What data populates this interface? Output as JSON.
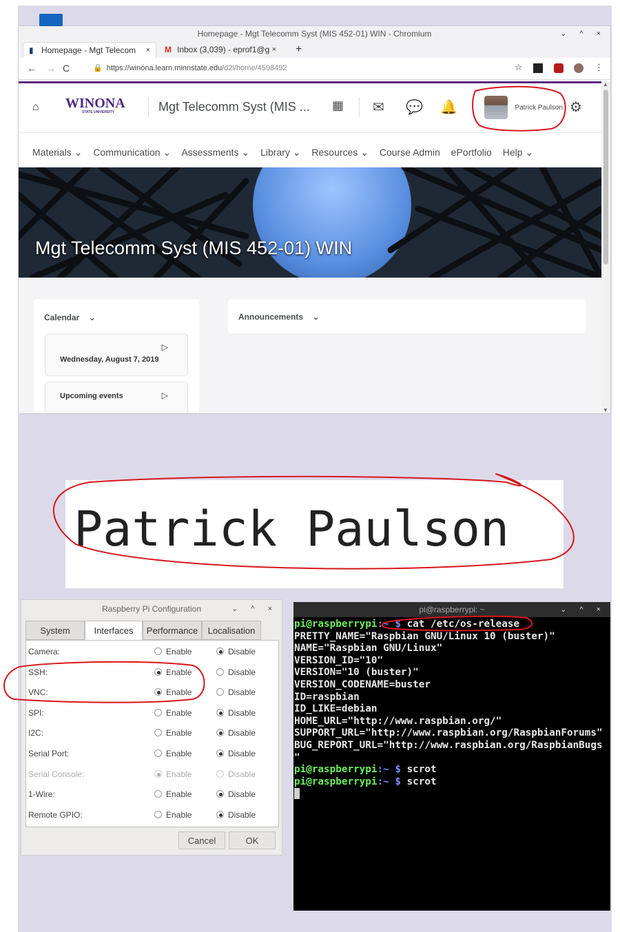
{
  "browser": {
    "window_title": "Homepage - Mgt Telecomm Syst (MIS 452-01) WIN - Chromium",
    "window_controls": "⌄ ^ ×",
    "tabs": [
      {
        "label": "Homepage - Mgt Telecom",
        "close": "×"
      },
      {
        "label": "Inbox (3,039) - eprof1@g",
        "close": "×"
      }
    ],
    "new_tab": "+",
    "url_host": "https://winona.learn.minnstate.edu",
    "url_path": "/d2l/home/4598492"
  },
  "d2l": {
    "logo_text": "WINONA",
    "logo_sub": "STATE UNIVERSITY",
    "course_short": "Mgt Telecomm Syst (MIS ...",
    "user_name": "Patrick Paulson",
    "menu": [
      "Materials ⌄",
      "Communication ⌄",
      "Assessments ⌄",
      "Library ⌄",
      "Resources ⌄",
      "Course Admin",
      "ePortfolio",
      "Help ⌄"
    ],
    "banner_title": "Mgt Telecomm Syst (MIS 452-01) WIN",
    "calendar_header": "Calendar",
    "calendar_date": "Wednesday, August 7, 2019",
    "upcoming_events": "Upcoming events",
    "announcements_header": "Announcements",
    "accent_color": "#4b2a84"
  },
  "name_banner": {
    "text": "Patrick Paulson"
  },
  "rpi_config": {
    "title": "Raspberry Pi Configuration",
    "tabs": [
      "System",
      "Interfaces",
      "Performance",
      "Localisation"
    ],
    "selected_tab": "Interfaces",
    "enable_label": "Enable",
    "disable_label": "Disable",
    "rows": [
      {
        "label": "Camera:",
        "enabled": false,
        "disabled_row": false
      },
      {
        "label": "SSH:",
        "enabled": true,
        "disabled_row": false
      },
      {
        "label": "VNC:",
        "enabled": true,
        "disabled_row": false
      },
      {
        "label": "SPI:",
        "enabled": false,
        "disabled_row": false
      },
      {
        "label": "I2C:",
        "enabled": false,
        "disabled_row": false
      },
      {
        "label": "Serial Port:",
        "enabled": false,
        "disabled_row": false
      },
      {
        "label": "Serial Console:",
        "enabled": true,
        "disabled_row": true
      },
      {
        "label": "1-Wire:",
        "enabled": false,
        "disabled_row": false
      },
      {
        "label": "Remote GPIO:",
        "enabled": false,
        "disabled_row": false
      }
    ],
    "cancel": "Cancel",
    "ok": "OK"
  },
  "terminal": {
    "title": "pi@raspberrypi: ~",
    "prompt_user": "pi@raspberrypi",
    "prompt_path": ":~",
    "prompt_sign": " $ ",
    "command1": "cat /etc/os-release",
    "output": [
      "PRETTY_NAME=\"Raspbian GNU/Linux 10 (buster)\"",
      "NAME=\"Raspbian GNU/Linux\"",
      "VERSION_ID=\"10\"",
      "VERSION=\"10 (buster)\"",
      "VERSION_CODENAME=buster",
      "ID=raspbian",
      "ID_LIKE=debian",
      "HOME_URL=\"http://www.raspbian.org/\"",
      "SUPPORT_URL=\"http://www.raspbian.org/RaspbianForums\"",
      "BUG_REPORT_URL=\"http://www.raspbian.org/RaspbianBugs",
      "\""
    ],
    "command2": "scrot",
    "command3": "scrot"
  }
}
